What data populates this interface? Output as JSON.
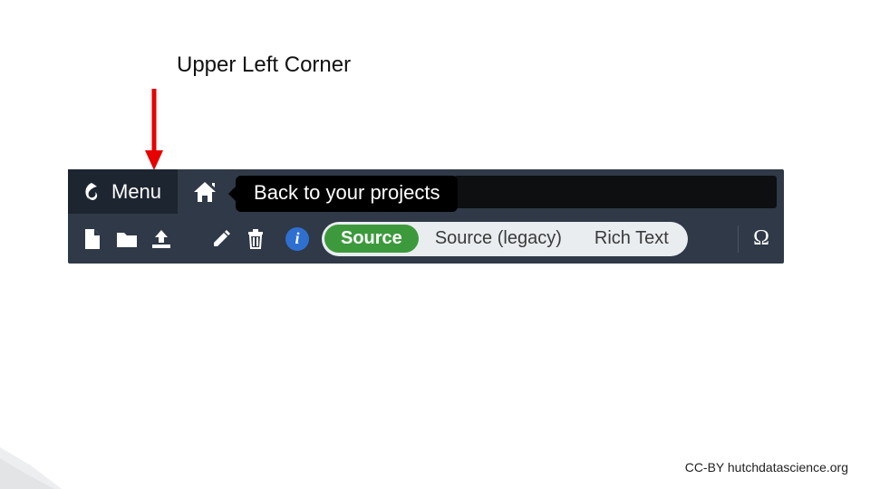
{
  "annotation": {
    "label": "Upper Left Corner"
  },
  "toolbar": {
    "menu_label": "Menu",
    "tooltip_text": "Back to your projects",
    "info_glyph": "i",
    "editor_modes": {
      "source": "Source",
      "source_legacy": "Source (legacy)",
      "rich_text": "Rich Text"
    },
    "omega_glyph": "Ω"
  },
  "footer": {
    "attribution": "CC-BY hutchdatascience.org"
  }
}
